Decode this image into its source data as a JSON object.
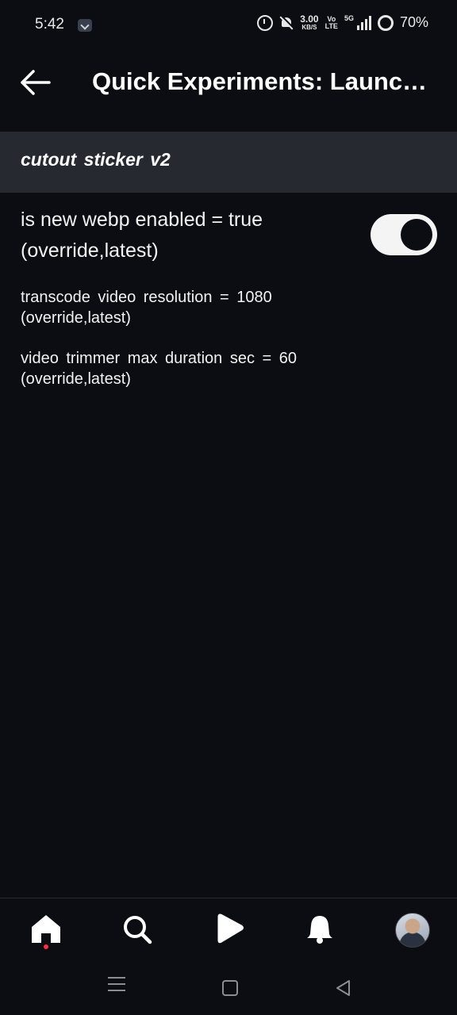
{
  "status_bar": {
    "time": "5:42",
    "net_speed_value": "3.00",
    "net_speed_unit": "KB/S",
    "volte_top": "Vo",
    "volte_bottom": "LTE",
    "network_type": "5G",
    "battery": "70%"
  },
  "app_bar": {
    "title": "Quick Experiments: Launc…"
  },
  "section": {
    "title": "cutout sticker v2"
  },
  "flags": {
    "toggle": {
      "label_line1": "is new webp enabled = true",
      "label_line2": "(override,latest)",
      "enabled": true
    },
    "items": [
      {
        "line1": "transcode video resolution = 1080",
        "line2": "(override,latest)"
      },
      {
        "line1": "video trimmer max duration sec = 60",
        "line2": "(override,latest)"
      }
    ]
  },
  "bottom_nav": {
    "tabs": [
      "home-icon",
      "search-icon",
      "reels-play-icon",
      "notifications-bell-icon",
      "profile-avatar"
    ],
    "active": "home-icon"
  },
  "colors": {
    "background": "#0b0d12",
    "section_header": "#262930",
    "toggle_on": "#f4f4f4",
    "badge_dot": "#ff3040"
  }
}
